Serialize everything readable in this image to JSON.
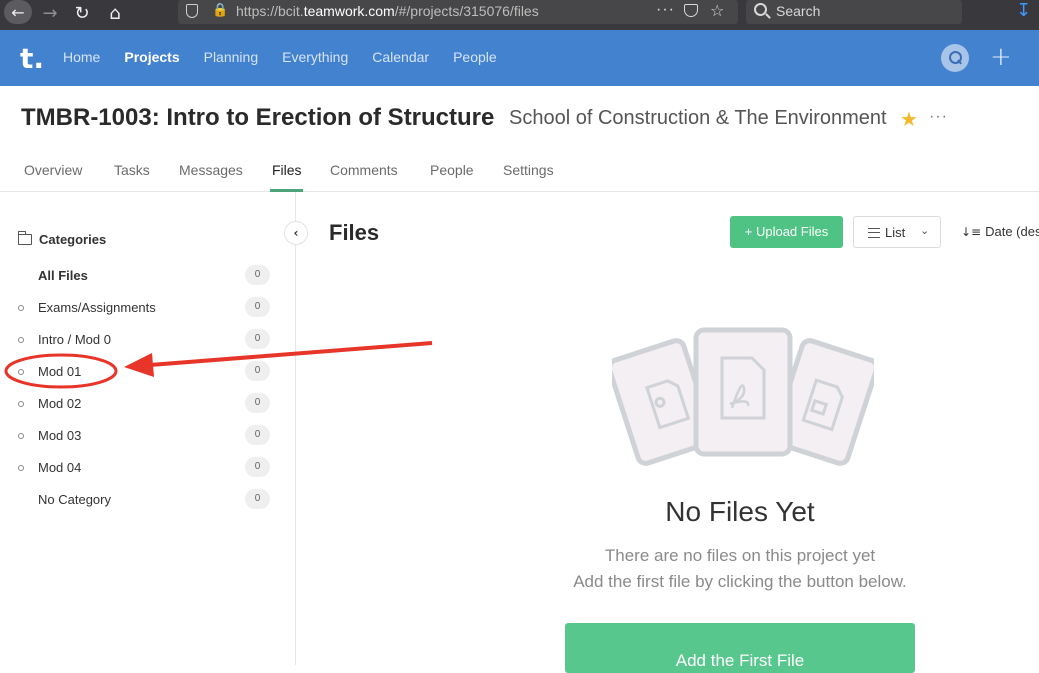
{
  "browser": {
    "url_prefix": "https://bcit.",
    "url_host": "teamwork.com",
    "url_suffix": "/#/projects/315076/files",
    "search_placeholder": "Search"
  },
  "app_nav": {
    "logo": "t.",
    "items": [
      "Home",
      "Projects",
      "Planning",
      "Everything",
      "Calendar",
      "People"
    ],
    "active": "Projects"
  },
  "project": {
    "title": "TMBR-1003: Intro to Erection of Structure",
    "subtitle": "School of Construction & The Environment",
    "more": "···"
  },
  "tabs": [
    "Overview",
    "Tasks",
    "Messages",
    "Files",
    "Comments",
    "People",
    "Settings"
  ],
  "sidebar": {
    "heading": "Categories",
    "items": [
      {
        "label": "All Files",
        "count": "0",
        "bold": true,
        "bullet": false
      },
      {
        "label": "Exams/Assignments",
        "count": "0",
        "bold": false,
        "bullet": true
      },
      {
        "label": "Intro / Mod 0",
        "count": "0",
        "bold": false,
        "bullet": true
      },
      {
        "label": "Mod 01",
        "count": "0",
        "bold": false,
        "bullet": true
      },
      {
        "label": "Mod 02",
        "count": "0",
        "bold": false,
        "bullet": true
      },
      {
        "label": "Mod 03",
        "count": "0",
        "bold": false,
        "bullet": true
      },
      {
        "label": "Mod 04",
        "count": "0",
        "bold": false,
        "bullet": true
      },
      {
        "label": "No Category",
        "count": "0",
        "bold": false,
        "bullet": false
      }
    ]
  },
  "main": {
    "title": "Files",
    "upload_label": "+ Upload Files",
    "view_label": "List",
    "sort_label": "Date (des"
  },
  "empty_state": {
    "title": "No Files Yet",
    "line1": "There are no files on this project yet",
    "line2": "Add the first file by clicking the button below.",
    "button": "Add the First File"
  },
  "colors": {
    "nav_blue": "#4382cf",
    "accent_green": "#4ec383",
    "annotation_red": "#e8352a"
  }
}
